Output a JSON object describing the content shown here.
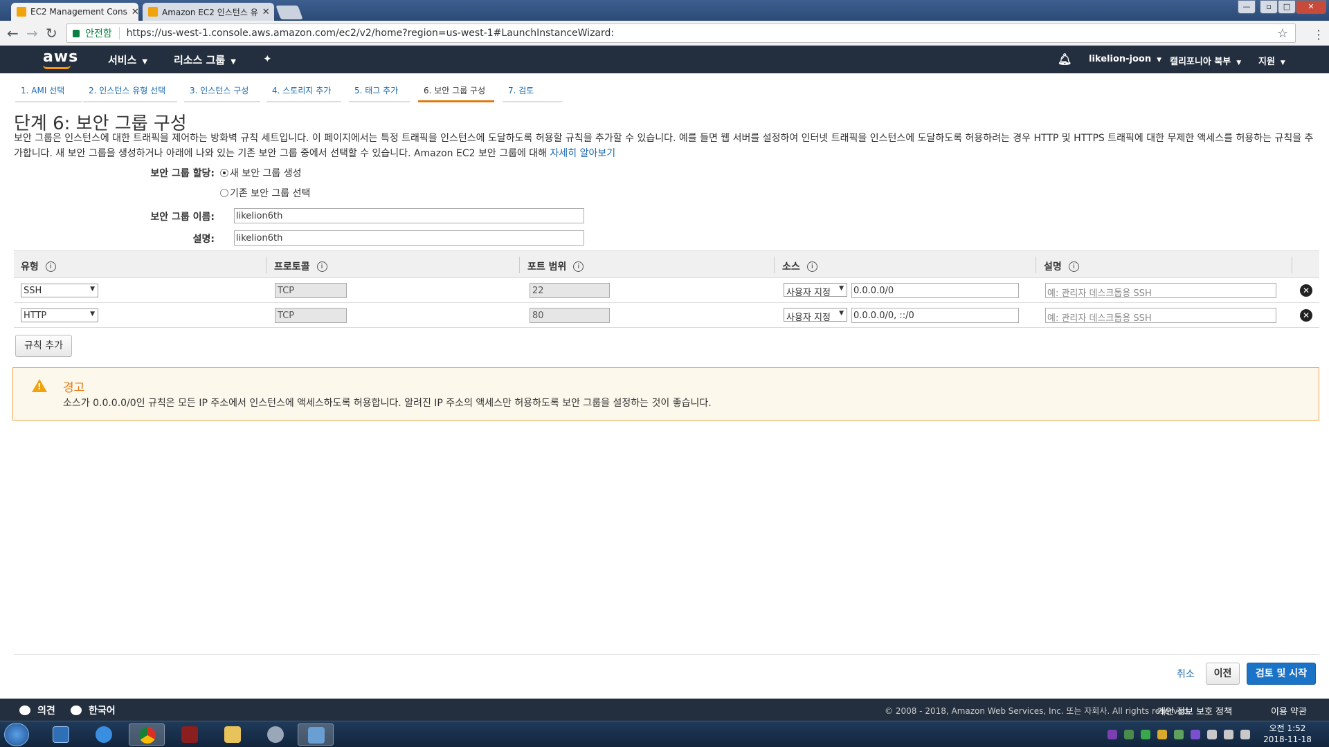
{
  "browser": {
    "tabs": [
      {
        "title": "EC2 Management Cons"
      },
      {
        "title": "Amazon EC2 인스턴스 유"
      }
    ],
    "secure_label": "안전함",
    "url": "https://us-west-1.console.aws.amazon.com/ec2/v2/home?region=us-west-1#LaunchInstanceWizard:"
  },
  "aws_header": {
    "logo": "aws",
    "services": "서비스",
    "resource_groups": "리소스 그룹",
    "user": "likelion-joon",
    "region": "캘리포니아 북부",
    "support": "지원"
  },
  "wizard_steps": [
    {
      "label": "1. AMI 선택"
    },
    {
      "label": "2. 인스턴스 유형 선택"
    },
    {
      "label": "3. 인스턴스 구성"
    },
    {
      "label": "4. 스토리지 추가"
    },
    {
      "label": "5. 태그 추가"
    },
    {
      "label": "6. 보안 그룹 구성"
    },
    {
      "label": "7. 검토"
    }
  ],
  "page": {
    "title": "단계 6: 보안 그룹 구성",
    "description": "보안 그룹은 인스턴스에 대한 트래픽을 제어하는 방화벽 규칙 세트입니다. 이 페이지에서는 특정 트래픽을 인스턴스에 도달하도록 허용할 규칙을 추가할 수 있습니다. 예를 들면 웹 서버를 설정하여 인터넷 트래픽을 인스턴스에 도달하도록 허용하려는 경우 HTTP 및 HTTPS 트래픽에 대한 무제한 액세스를 허용하는 규칙을 추가합니다. 새 보안 그룹을 생성하거나 아래에 나와 있는 기존 보안 그룹 중에서 선택할 수 있습니다. Amazon EC2 보안 그룹에 대해",
    "learn_more": "자세히 알아보기"
  },
  "form": {
    "assign_label": "보안 그룹 할당:",
    "radio_new": "새 보안 그룹 생성",
    "radio_existing": "기존 보안 그룹 선택",
    "name_label": "보안 그룹 이름:",
    "name_value": "likelion6th",
    "desc_label": "설명:",
    "desc_value": "likelion6th"
  },
  "rules_table": {
    "headers": [
      "유형",
      "프로토콜",
      "포트 범위",
      "소스",
      "설명"
    ],
    "rows": [
      {
        "type": "SSH",
        "protocol": "TCP",
        "port": "22",
        "source_type": "사용자 지정",
        "source": "0.0.0.0/0",
        "desc_placeholder": "예: 관리자 데스크톱용 SSH"
      },
      {
        "type": "HTTP",
        "protocol": "TCP",
        "port": "80",
        "source_type": "사용자 지정",
        "source": "0.0.0.0/0, ::/0",
        "desc_placeholder": "예: 관리자 데스크톱용 SSH"
      }
    ],
    "add_rule": "규칙 추가"
  },
  "warning": {
    "title": "경고",
    "text": "소스가 0.0.0.0/0인 규칙은 모든 IP 주소에서 인스턴스에 액세스하도록 허용합니다. 알려진 IP 주소의 액세스만 허용하도록 보안 그룹을 설정하는 것이 좋습니다."
  },
  "actions": {
    "cancel": "취소",
    "previous": "이전",
    "review_launch": "검토 및 시작"
  },
  "aws_footer": {
    "feedback": "의견",
    "language": "한국어",
    "copyright": "© 2008 - 2018, Amazon Web Services, Inc. 또는 자회사. All rights reserved.",
    "privacy": "개인 정보 보호 정책",
    "terms": "이용 약관"
  },
  "taskbar": {
    "time": "오전 1:52",
    "date": "2018-11-18"
  },
  "colors": {
    "aws_navy": "#232f3e",
    "orange": "#e47911",
    "link_blue": "#1a6ab0",
    "primary_button": "#1a73c6"
  }
}
